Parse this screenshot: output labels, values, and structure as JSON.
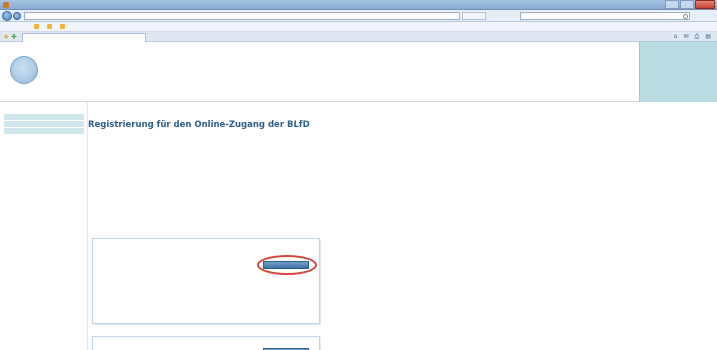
{
  "browser": {
    "title": "",
    "url": "",
    "search_placeholder": "",
    "menu": [
      "",
      "",
      "",
      "",
      ""
    ],
    "favorites": [
      "",
      "",
      ""
    ],
    "tab_label": "",
    "command_glyphs": [
      "⌂",
      "✉",
      "⎙",
      "▤"
    ]
  },
  "header": {
    "logo_text": "",
    "brand_line1": "",
    "brand_line2": "",
    "quicklinks": [
      "",
      "",
      "",
      ""
    ]
  },
  "sidebar": {
    "group1": [
      "",
      "",
      ""
    ],
    "group2": [
      ""
    ],
    "group3": [
      ""
    ]
  },
  "content": {
    "heading": "Registrierung für den Online-Zugang der BLfD",
    "para1": "",
    "para2": "",
    "para3": "",
    "card1": {
      "line1": "",
      "line2": "",
      "button": "",
      "link1": "",
      "link2": ""
    },
    "card2": {
      "line_prefix": "",
      "line_red": "",
      "line_suffix": "",
      "button": ""
    }
  },
  "colors": {
    "accent": "#2d5f86",
    "sidebar_active": "#cfe6ec",
    "quicklinks_bg": "#b8dbe4",
    "highlight": "#d2473a"
  }
}
